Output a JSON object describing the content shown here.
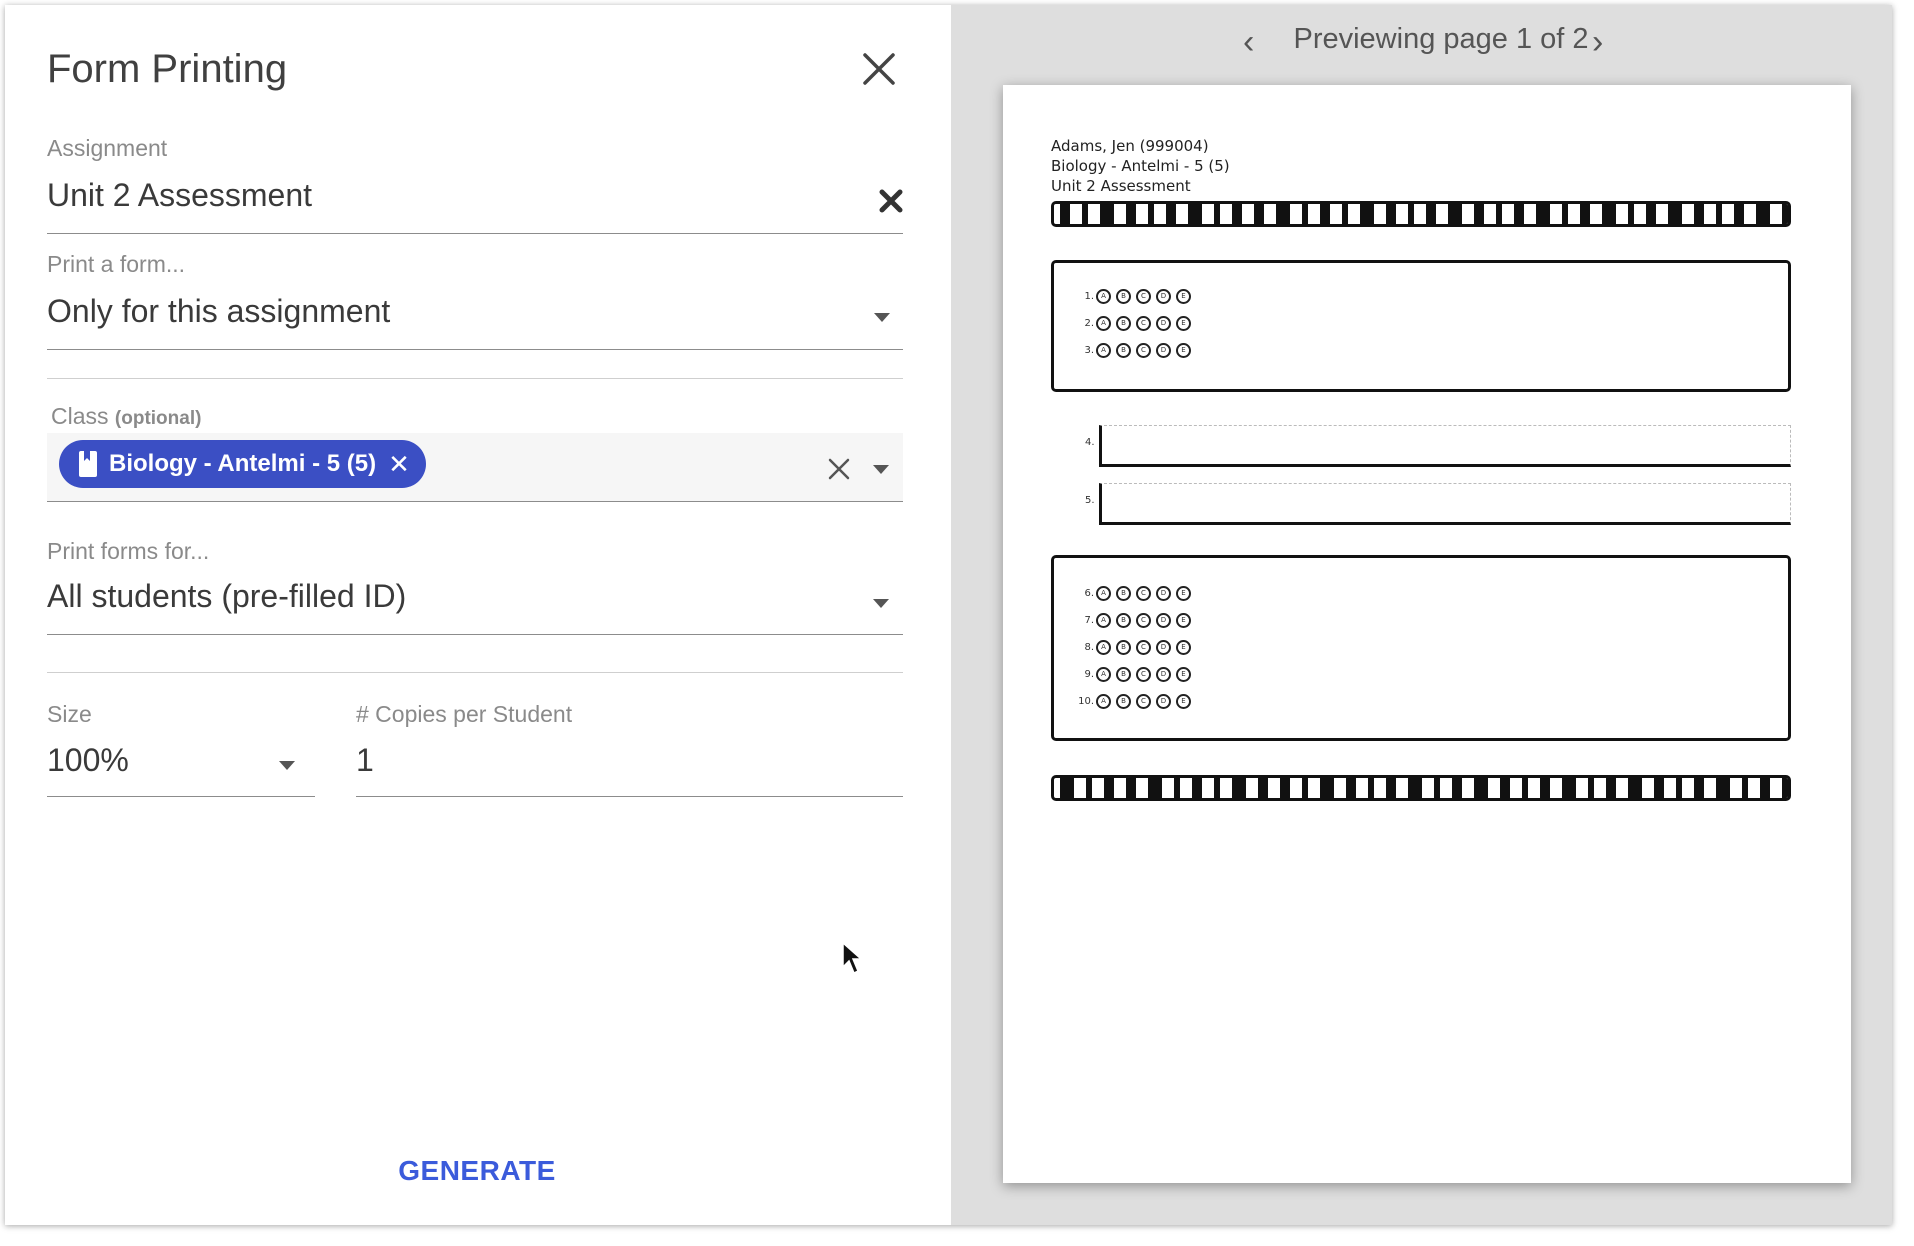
{
  "dialog": {
    "title": "Form Printing",
    "generate_label": "GENERATE"
  },
  "form": {
    "assignment": {
      "label": "Assignment",
      "value": "Unit 2 Assessment"
    },
    "print_form": {
      "label": "Print a form...",
      "value": "Only for this assignment"
    },
    "class": {
      "label": "Class",
      "label_suffix": "(optional)",
      "chip": "Biology - Antelmi - 5 (5)"
    },
    "print_for": {
      "label": "Print forms for...",
      "value": "All students (pre-filled ID)"
    },
    "size": {
      "label": "Size",
      "value": "100%"
    },
    "copies": {
      "label": "# Copies per Student",
      "value": "1"
    }
  },
  "preview": {
    "pager_text": "Previewing page 1 of 2",
    "sheet": {
      "student": "Adams, Jen (999004)",
      "class": "Biology - Antelmi - 5 (5)",
      "assignment": "Unit 2 Assessment",
      "group1": [
        {
          "num": "1.",
          "choices": [
            "A",
            "B",
            "C",
            "D",
            "E"
          ]
        },
        {
          "num": "2.",
          "choices": [
            "A",
            "B",
            "C",
            "D",
            "E"
          ]
        },
        {
          "num": "3.",
          "choices": [
            "A",
            "B",
            "C",
            "D",
            "E"
          ]
        }
      ],
      "text_questions": [
        "4.",
        "5."
      ],
      "group2": [
        {
          "num": "6.",
          "choices": [
            "A",
            "B",
            "C",
            "D",
            "E"
          ]
        },
        {
          "num": "7.",
          "choices": [
            "A",
            "B",
            "C",
            "D",
            "E"
          ]
        },
        {
          "num": "8.",
          "choices": [
            "A",
            "B",
            "C",
            "D",
            "E"
          ]
        },
        {
          "num": "9.",
          "choices": [
            "A",
            "B",
            "C",
            "D",
            "E"
          ]
        },
        {
          "num": "10.",
          "choices": [
            "A",
            "B",
            "C",
            "D",
            "E"
          ]
        }
      ]
    }
  },
  "colors": {
    "accent": "#3b4fc4",
    "link": "#3b5bdb",
    "preview_bg": "#dedede"
  }
}
